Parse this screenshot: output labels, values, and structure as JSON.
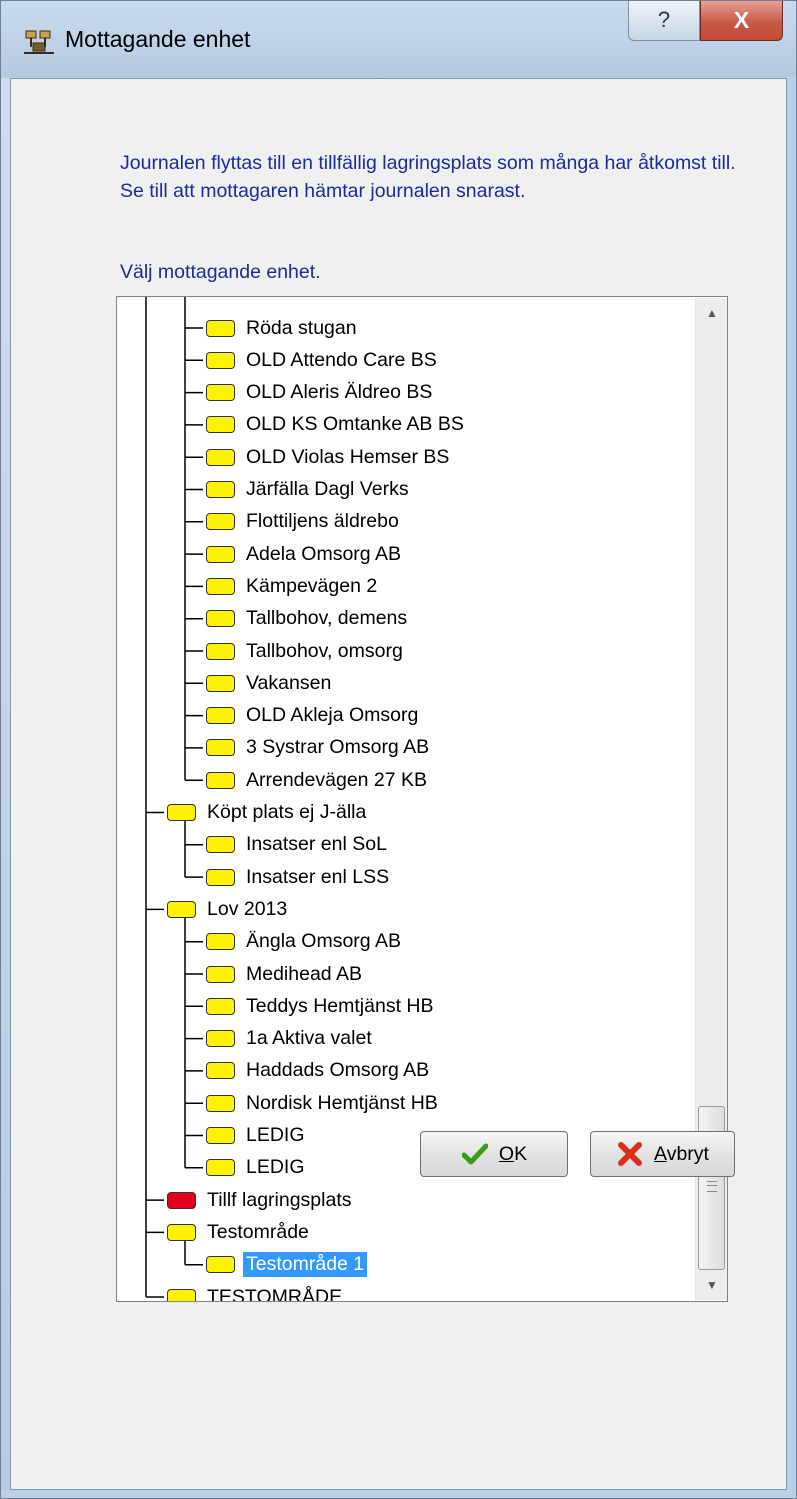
{
  "window": {
    "title": "Mottagande enhet",
    "help_glyph": "?",
    "close_glyph": "X"
  },
  "info_lines": [
    "Journalen flyttas till en tillfällig lagringsplats som många har åtkomst till.",
    "Se till att mottagaren hämtar journalen snarast."
  ],
  "tree_label": "Välj mottagande enhet.",
  "tree_items": [
    {
      "label": "Röda stugan",
      "level": 2,
      "color": "yellow"
    },
    {
      "label": "OLD Attendo Care BS",
      "level": 2,
      "color": "yellow"
    },
    {
      "label": "OLD Aleris Äldreo BS",
      "level": 2,
      "color": "yellow"
    },
    {
      "label": "OLD KS Omtanke AB BS",
      "level": 2,
      "color": "yellow"
    },
    {
      "label": "OLD Violas Hemser BS",
      "level": 2,
      "color": "yellow"
    },
    {
      "label": "Järfälla Dagl Verks",
      "level": 2,
      "color": "yellow"
    },
    {
      "label": "Flottiljens äldrebo",
      "level": 2,
      "color": "yellow"
    },
    {
      "label": "Adela Omsorg AB",
      "level": 2,
      "color": "yellow"
    },
    {
      "label": "Kämpevägen 2",
      "level": 2,
      "color": "yellow"
    },
    {
      "label": "Tallbohov, demens",
      "level": 2,
      "color": "yellow"
    },
    {
      "label": "Tallbohov, omsorg",
      "level": 2,
      "color": "yellow"
    },
    {
      "label": "Vakansen",
      "level": 2,
      "color": "yellow"
    },
    {
      "label": "OLD Akleja Omsorg",
      "level": 2,
      "color": "yellow"
    },
    {
      "label": "3 Systrar Omsorg AB",
      "level": 2,
      "color": "yellow"
    },
    {
      "label": "Arrendevägen 27 KB",
      "level": 2,
      "color": "yellow"
    },
    {
      "label": "Köpt plats ej J-älla",
      "level": 1,
      "color": "yellow"
    },
    {
      "label": "Insatser enl SoL",
      "level": 2,
      "color": "yellow"
    },
    {
      "label": "Insatser enl LSS",
      "level": 2,
      "color": "yellow"
    },
    {
      "label": "Lov 2013",
      "level": 1,
      "color": "yellow"
    },
    {
      "label": "Ängla Omsorg AB",
      "level": 2,
      "color": "yellow"
    },
    {
      "label": "Medihead AB",
      "level": 2,
      "color": "yellow"
    },
    {
      "label": "Teddys Hemtjänst HB",
      "level": 2,
      "color": "yellow"
    },
    {
      "label": "1a Aktiva valet",
      "level": 2,
      "color": "yellow"
    },
    {
      "label": "Haddads Omsorg AB",
      "level": 2,
      "color": "yellow"
    },
    {
      "label": "Nordisk Hemtjänst HB",
      "level": 2,
      "color": "yellow"
    },
    {
      "label": "LEDIG",
      "level": 2,
      "color": "yellow"
    },
    {
      "label": "LEDIG",
      "level": 2,
      "color": "yellow"
    },
    {
      "label": "Tillf lagringsplats",
      "level": 1,
      "color": "red"
    },
    {
      "label": "Testområde",
      "level": 1,
      "color": "yellow"
    },
    {
      "label": "Testområde 1",
      "level": 2,
      "color": "yellow",
      "selected": true
    },
    {
      "label": "TESTOMRÅDE",
      "level": 1,
      "color": "yellow"
    }
  ],
  "buttons": {
    "ok_label": "OK",
    "cancel_label": "Avbryt"
  },
  "colors": {
    "folder_yellow": "#fff203",
    "folder_red": "#e2001a",
    "selection": "#3399ff",
    "info_text": "#1a2b9c"
  }
}
